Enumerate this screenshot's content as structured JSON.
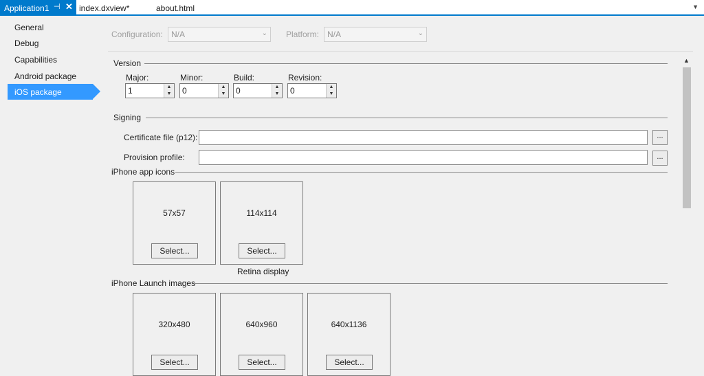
{
  "tabs": {
    "active": {
      "label": "Application1",
      "pin_icon": "pin-icon",
      "close_icon": "close-icon"
    },
    "others": [
      "index.dxview*",
      "about.html"
    ],
    "overflow_icon": "dropdown-arrow-icon"
  },
  "sidebar": {
    "items": [
      "General",
      "Debug",
      "Capabilities",
      "Android package",
      "iOS package"
    ],
    "active_index": 4
  },
  "config": {
    "configuration_label": "Configuration:",
    "configuration_value": "N/A",
    "platform_label": "Platform:",
    "platform_value": "N/A"
  },
  "version": {
    "title": "Version",
    "fields": [
      {
        "label": "Major:",
        "value": "1"
      },
      {
        "label": "Minor:",
        "value": "0"
      },
      {
        "label": "Build:",
        "value": "0"
      },
      {
        "label": "Revision:",
        "value": "0"
      }
    ]
  },
  "signing": {
    "title": "Signing",
    "certificate_label": "Certificate file (p12):",
    "certificate_value": "",
    "provision_label": "Provision profile:",
    "provision_value": "",
    "browse_label": "..."
  },
  "iphone_icons": {
    "title": "iPhone app icons",
    "boxes": [
      {
        "size": "57x57",
        "button": "Select...",
        "caption": ""
      },
      {
        "size": "114x114",
        "button": "Select...",
        "caption": "Retina display"
      }
    ]
  },
  "iphone_launch": {
    "title": "iPhone Launch images",
    "boxes": [
      {
        "size": "320x480",
        "button": "Select..."
      },
      {
        "size": "640x960",
        "button": "Select..."
      },
      {
        "size": "640x1136",
        "button": "Select..."
      }
    ]
  },
  "colors": {
    "accent": "#007acc",
    "selection": "#3399ff",
    "background": "#f0f0f0"
  }
}
